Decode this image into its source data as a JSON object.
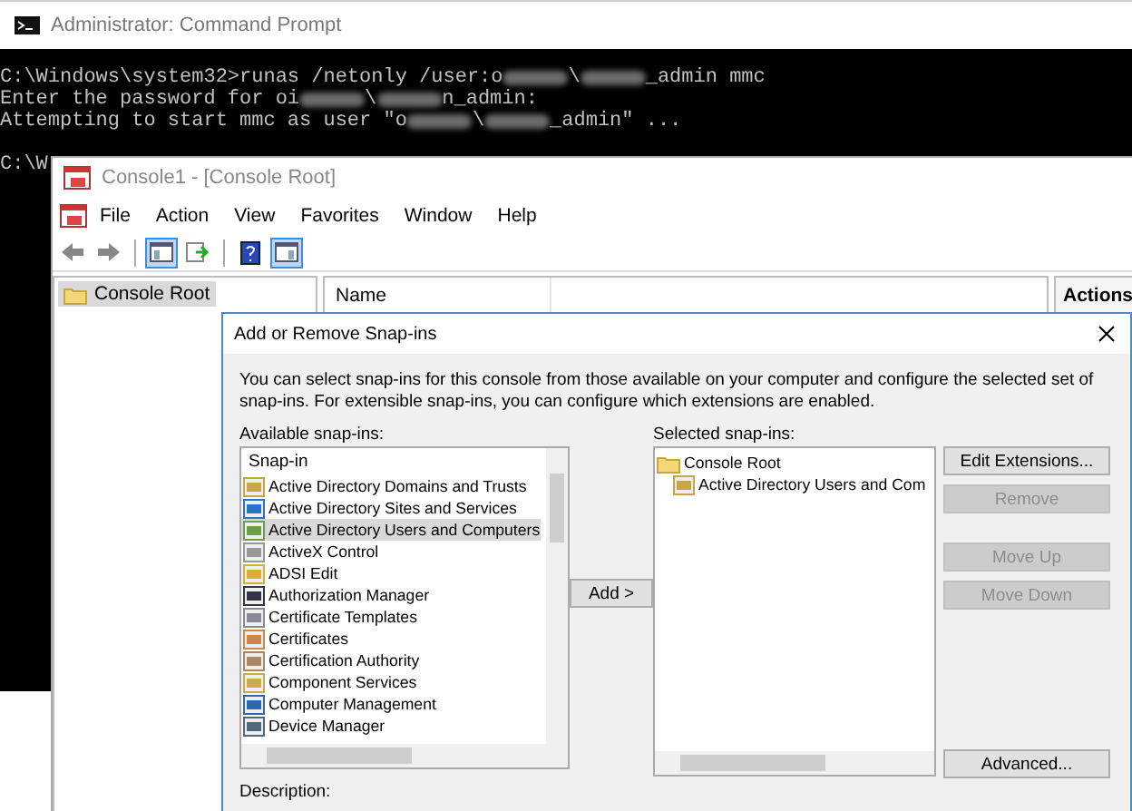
{
  "cmd_window": {
    "title": "Administrator: Command Prompt",
    "lines": [
      [
        {
          "kind": "text",
          "text": "C:\\Windows\\system32>runas /netonly /user:o"
        },
        {
          "kind": "redacted"
        },
        {
          "kind": "text",
          "text": "\\"
        },
        {
          "kind": "redacted"
        },
        {
          "kind": "text",
          "text": "_admin mmc"
        }
      ],
      [
        {
          "kind": "text",
          "text": "Enter the password for oi"
        },
        {
          "kind": "redacted"
        },
        {
          "kind": "text",
          "text": "\\"
        },
        {
          "kind": "redacted"
        },
        {
          "kind": "text",
          "text": "n_admin:"
        }
      ],
      [
        {
          "kind": "text",
          "text": "Attempting to start mmc as user \"o"
        },
        {
          "kind": "redacted"
        },
        {
          "kind": "text",
          "text": "\\"
        },
        {
          "kind": "redacted"
        },
        {
          "kind": "text",
          "text": "_admin\" ..."
        }
      ],
      [
        {
          "kind": "text",
          "text": "C:\\W"
        }
      ]
    ]
  },
  "mmc_window": {
    "title": "Console1 - [Console Root]",
    "menu": [
      "File",
      "Action",
      "View",
      "Favorites",
      "Window",
      "Help"
    ],
    "toolbar": [
      {
        "kind": "back",
        "pressed": false
      },
      {
        "kind": "forward",
        "pressed": false
      },
      {
        "kind": "tree",
        "pressed": true
      },
      {
        "kind": "export",
        "pressed": false
      },
      {
        "kind": "help",
        "pressed": false
      },
      {
        "kind": "pane",
        "pressed": true
      }
    ],
    "tree": [
      {
        "label": "Console Root",
        "selected": true
      }
    ],
    "columns": [
      "Name"
    ],
    "actions_title": "Actions"
  },
  "dialog": {
    "title": "Add or Remove Snap-ins",
    "intro": "You can select snap-ins for this console from those available on your computer and configure the selected set of snap-ins. For extensible snap-ins, you can configure which extensions are enabled.",
    "available_label": "Available snap-ins:",
    "available_header": "Snap-in",
    "available": [
      {
        "label": "Active Directory Domains and Trusts",
        "selected": false
      },
      {
        "label": "Active Directory Sites and Services",
        "selected": false
      },
      {
        "label": "Active Directory Users and Computers",
        "selected": true
      },
      {
        "label": "ActiveX Control",
        "selected": false
      },
      {
        "label": "ADSI Edit",
        "selected": false
      },
      {
        "label": "Authorization Manager",
        "selected": false
      },
      {
        "label": "Certificate Templates",
        "selected": false
      },
      {
        "label": "Certificates",
        "selected": false
      },
      {
        "label": "Certification Authority",
        "selected": false
      },
      {
        "label": "Component Services",
        "selected": false
      },
      {
        "label": "Computer Management",
        "selected": false
      },
      {
        "label": "Device Manager",
        "selected": false
      }
    ],
    "add_button": "Add >",
    "selected_label": "Selected snap-ins:",
    "selected_tree": [
      {
        "label": "Console Root",
        "children": [
          {
            "label": "Active Directory Users and Com"
          }
        ]
      }
    ],
    "buttons": [
      {
        "label": "Edit Extensions...",
        "disabled": false
      },
      {
        "label": "Remove",
        "disabled": true
      },
      {
        "label": "Move Up",
        "disabled": true
      },
      {
        "label": "Move Down",
        "disabled": true
      },
      {
        "label": "Advanced...",
        "disabled": false
      }
    ],
    "description_label": "Description:"
  }
}
